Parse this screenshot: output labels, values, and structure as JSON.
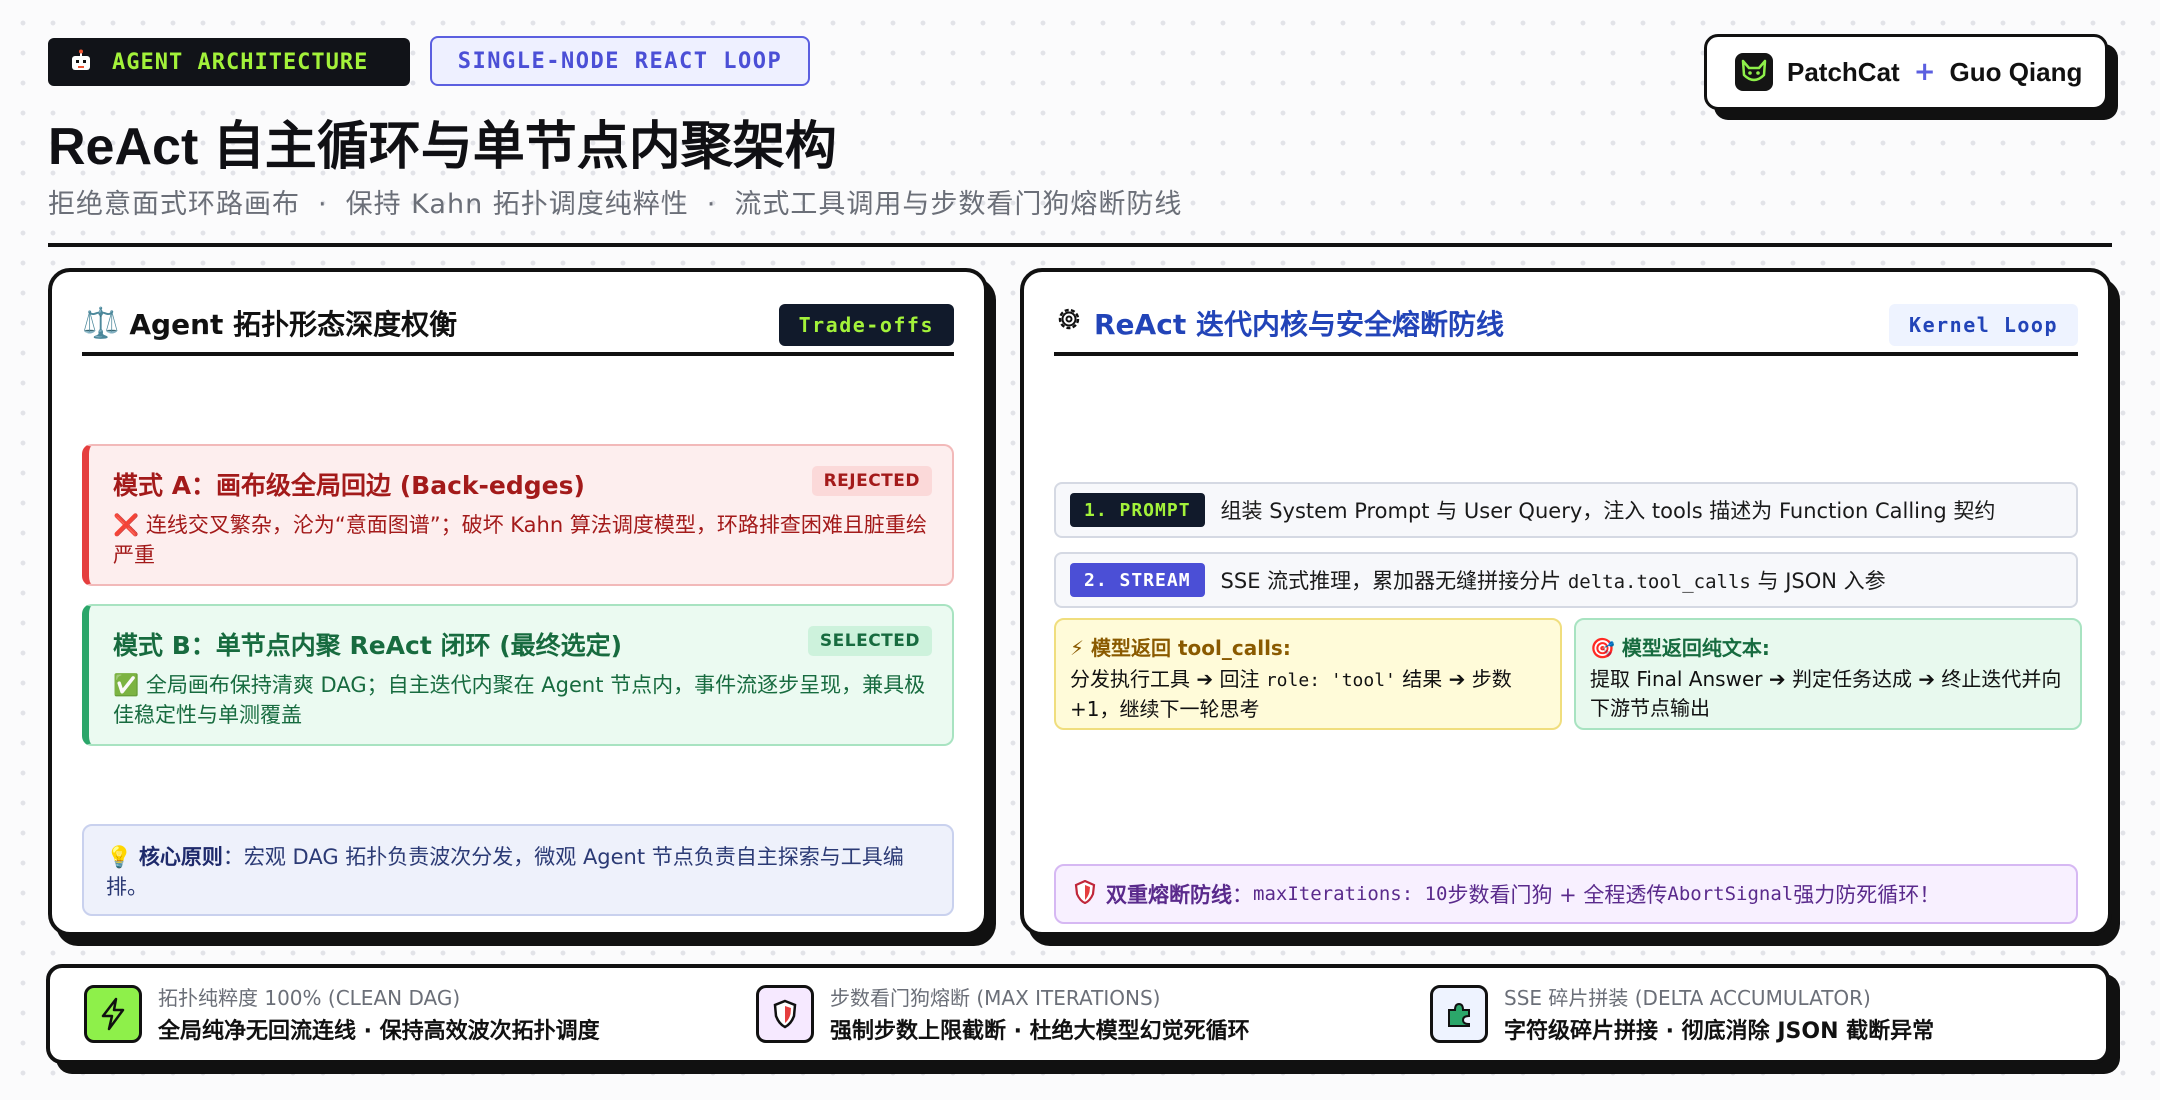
{
  "header": {
    "tag_dark": "AGENT ARCHITECTURE",
    "tag_outline": "SINGLE-NODE REACT LOOP",
    "brand_name": "PatchCat",
    "brand_plus": "+",
    "brand_author": "Guo Qiang",
    "title": "ReAct 自主循环与单节点内聚架构",
    "subtitle_1": "拒绝意面式环路画布",
    "subtitle_2": "保持 Kahn 拓扑调度纯粹性",
    "subtitle_3": "流式工具调用与步数看门狗熔断防线",
    "subtitle_sep": "·"
  },
  "left_panel": {
    "icon": "⚖️",
    "title": "Agent 拓扑形态深度权衡",
    "pill": "Trade-offs",
    "mode_a": {
      "title": "模式 A：画布级全局回边 (Back-edges)",
      "badge": "REJECTED",
      "icon": "❌",
      "desc": "连线交叉繁杂，沦为“意面图谱”；破坏 Kahn 算法调度模型，环路排查困难且脏重绘严重"
    },
    "mode_b": {
      "title": "模式 B：单节点内聚 ReAct 闭环 (最终选定)",
      "badge": "SELECTED",
      "icon": "✅",
      "desc": "全局画布保持清爽 DAG；自主迭代内聚在 Agent 节点内，事件流逐步呈现，兼具极佳稳定性与单测覆盖"
    },
    "principle": {
      "icon": "💡",
      "label": "核心原则",
      "text": "：宏观 DAG 拓扑负责波次分发，微观 Agent 节点负责自主探索与工具编排。"
    }
  },
  "right_panel": {
    "title": "ReAct 迭代内核与安全熔断防线",
    "pill": "Kernel Loop",
    "step1": {
      "num": "1. PROMPT",
      "text": "组装 System Prompt 与 User Query，注入 tools 描述为 Function Calling 契约"
    },
    "step2": {
      "num": "2. STREAM",
      "text_a": "SSE 流式推理，累加器无缝拼接分片 ",
      "code": "delta.tool_calls",
      "text_b": " 与 JSON 入参"
    },
    "branch_tool": {
      "icon": "⚡",
      "title": "模型返回 tool_calls:",
      "text_a": "分发执行工具 ➔ 回注 ",
      "code": "role: 'tool'",
      "text_b": " 结果 ➔ 步数 +1，继续下一轮思考"
    },
    "branch_text": {
      "icon": "🎯",
      "title": "模型返回纯文本:",
      "text": "提取 Final Answer ➔ 判定任务达成 ➔ 终止迭代并向下游节点输出"
    },
    "fuse": {
      "label": "双重熔断防线",
      "sep": "：",
      "code1": "maxIterations: 10",
      "text_a": " 步数看门狗 + 全程透传 ",
      "code2": "AbortSignal",
      "text_b": " 强力防死循环！"
    }
  },
  "footer": {
    "f1_l1": "拓扑纯粹度 100% (CLEAN DAG)",
    "f1_l2": "全局纯净无回流连线 · 保持高效波次拓扑调度",
    "f2_l1": "步数看门狗熔断 (MAX ITERATIONS)",
    "f2_l2": "强制步数上限截断 · 杜绝大模型幻觉死循环",
    "f3_l1": "SSE 碎片拼装 (DELTA ACCUMULATOR)",
    "f3_l2": "字符级碎片拼接 · 彻底消除 JSON 截断异常"
  }
}
